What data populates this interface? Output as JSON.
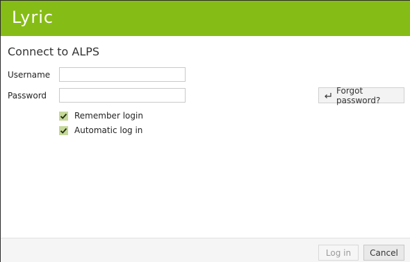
{
  "app": {
    "logo_text": "Lyric",
    "brand_color": "#86bc16"
  },
  "form": {
    "title": "Connect to ALPS",
    "username": {
      "label": "Username",
      "value": ""
    },
    "password": {
      "label": "Password",
      "value": ""
    },
    "forgot_password_label": "Forgot password?",
    "forgot_password_icon": "return-arrow-icon",
    "remember_login": {
      "label": "Remember login",
      "checked": true
    },
    "automatic_login": {
      "label": "Automatic log in",
      "checked": true
    }
  },
  "footer": {
    "login_label": "Log in",
    "login_enabled": false,
    "cancel_label": "Cancel"
  }
}
